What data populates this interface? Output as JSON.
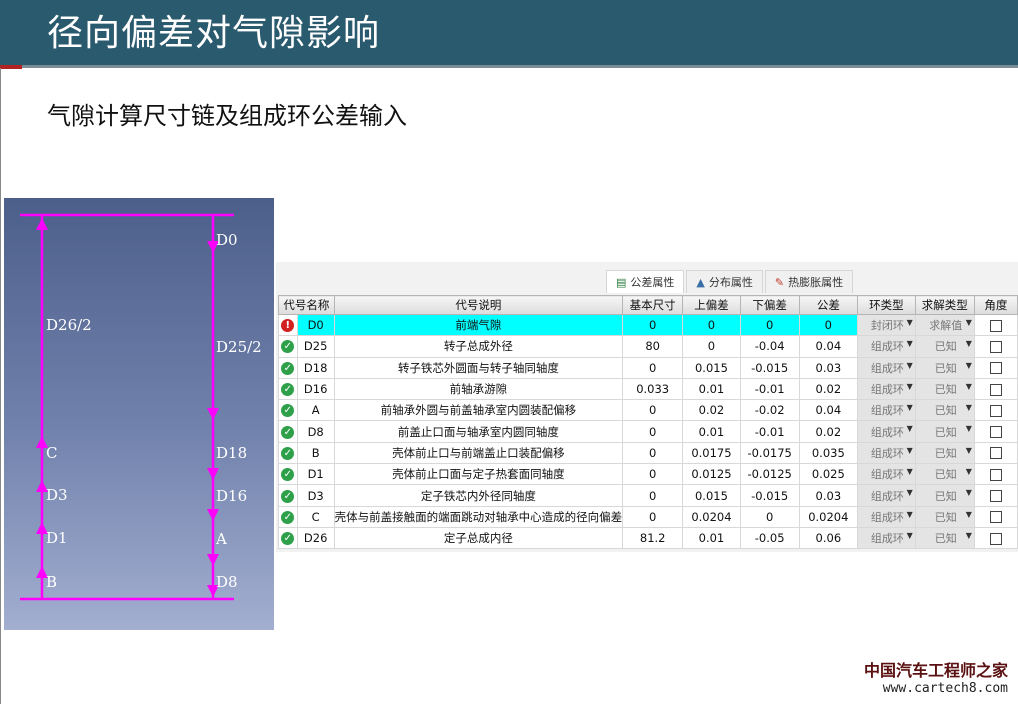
{
  "slide": {
    "title": "径向偏差对气隙影响",
    "subtitle": "气隙计算尺寸链及组成环公差输入"
  },
  "diagram": {
    "left_labels": [
      "D26/2",
      "C",
      "D3",
      "D1",
      "B"
    ],
    "right_labels": [
      "D0",
      "D25/2",
      "D18",
      "D16",
      "A",
      "D8"
    ],
    "line_color": "#ff00ff"
  },
  "tabs": [
    {
      "label": "公差属性",
      "icon": "table-icon"
    },
    {
      "label": "分布属性",
      "icon": "bell-curve-icon"
    },
    {
      "label": "热膨胀属性",
      "icon": "pencil-icon"
    }
  ],
  "table": {
    "headers": [
      "代号名称",
      "代号说明",
      "基本尺寸",
      "上偏差",
      "下偏差",
      "公差",
      "环类型",
      "求解类型",
      "角度"
    ],
    "rows": [
      {
        "status": "error",
        "code": "D0",
        "desc": "前端气隙",
        "basic": "0",
        "upper": "0",
        "lower": "0",
        "tol": "0",
        "ring": "封闭环",
        "solve": "求解值"
      },
      {
        "status": "ok",
        "code": "D25",
        "desc": "转子总成外径",
        "basic": "80",
        "upper": "0",
        "lower": "-0.04",
        "tol": "0.04",
        "ring": "组成环",
        "solve": "已知"
      },
      {
        "status": "ok",
        "code": "D18",
        "desc": "转子铁芯外圆面与转子轴同轴度",
        "basic": "0",
        "upper": "0.015",
        "lower": "-0.015",
        "tol": "0.03",
        "ring": "组成环",
        "solve": "已知"
      },
      {
        "status": "ok",
        "code": "D16",
        "desc": "前轴承游隙",
        "basic": "0.033",
        "upper": "0.01",
        "lower": "-0.01",
        "tol": "0.02",
        "ring": "组成环",
        "solve": "已知"
      },
      {
        "status": "ok",
        "code": "A",
        "desc": "前轴承外圆与前盖轴承室内圆装配偏移",
        "basic": "0",
        "upper": "0.02",
        "lower": "-0.02",
        "tol": "0.04",
        "ring": "组成环",
        "solve": "已知"
      },
      {
        "status": "ok",
        "code": "D8",
        "desc": "前盖止口面与轴承室内圆同轴度",
        "basic": "0",
        "upper": "0.01",
        "lower": "-0.01",
        "tol": "0.02",
        "ring": "组成环",
        "solve": "已知"
      },
      {
        "status": "ok",
        "code": "B",
        "desc": "壳体前止口与前端盖止口装配偏移",
        "basic": "0",
        "upper": "0.0175",
        "lower": "-0.0175",
        "tol": "0.035",
        "ring": "组成环",
        "solve": "已知"
      },
      {
        "status": "ok",
        "code": "D1",
        "desc": "壳体前止口面与定子热套面同轴度",
        "basic": "0",
        "upper": "0.0125",
        "lower": "-0.0125",
        "tol": "0.025",
        "ring": "组成环",
        "solve": "已知"
      },
      {
        "status": "ok",
        "code": "D3",
        "desc": "定子铁芯内外径同轴度",
        "basic": "0",
        "upper": "0.015",
        "lower": "-0.015",
        "tol": "0.03",
        "ring": "组成环",
        "solve": "已知"
      },
      {
        "status": "ok",
        "code": "C",
        "desc": "壳体与前盖接触面的端面跳动对轴承中心造成的径向偏差",
        "basic": "0",
        "upper": "0.0204",
        "lower": "0",
        "tol": "0.0204",
        "ring": "组成环",
        "solve": "已知"
      },
      {
        "status": "ok",
        "code": "D26",
        "desc": "定子总成内径",
        "basic": "81.2",
        "upper": "0.01",
        "lower": "-0.05",
        "tol": "0.06",
        "ring": "组成环",
        "solve": "已知"
      }
    ]
  },
  "watermark": {
    "cn": "中国汽车工程师之家",
    "url": "www.cartech8.com"
  }
}
